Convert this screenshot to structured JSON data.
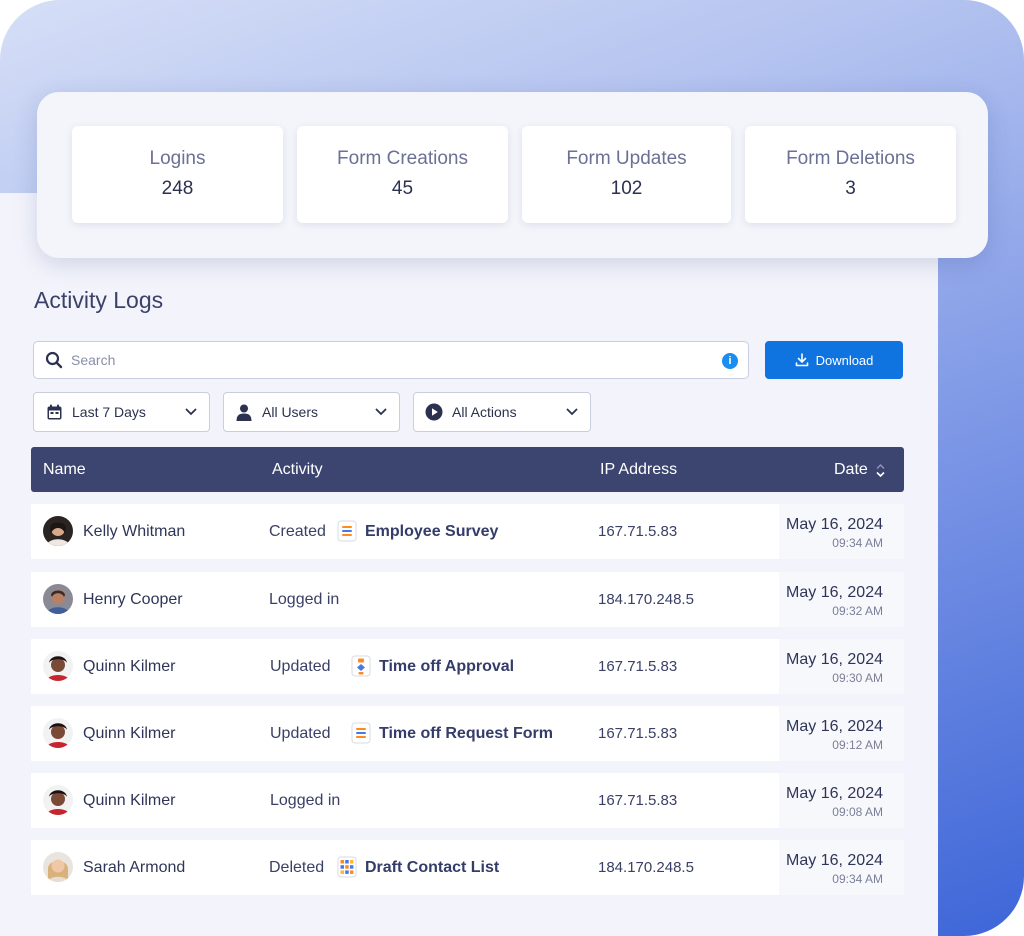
{
  "stats": [
    {
      "label": "Logins",
      "value": "248"
    },
    {
      "label": "Form Creations",
      "value": "45"
    },
    {
      "label": "Form Updates",
      "value": "102"
    },
    {
      "label": "Form Deletions",
      "value": "3"
    }
  ],
  "page_title": "Activity Logs",
  "search": {
    "placeholder": "Search",
    "value": ""
  },
  "download_label": "Download",
  "filters": {
    "date": {
      "label": "Last 7 Days",
      "icon": "calendar-icon"
    },
    "users": {
      "label": "All Users",
      "icon": "user-icon"
    },
    "actions": {
      "label": "All Actions",
      "icon": "play-circle-icon"
    }
  },
  "table": {
    "headers": {
      "name": "Name",
      "activity": "Activity",
      "ip": "IP Address",
      "date": "Date"
    },
    "rows": [
      {
        "name": "Kelly Whitman",
        "action": "Created",
        "form": "Employee Survey",
        "form_icon": "form-doc-icon",
        "ip": "167.71.5.83",
        "date": "May 16, 2024",
        "time": "09:34 AM"
      },
      {
        "name": "Henry Cooper",
        "action": "Logged in",
        "form": "",
        "form_icon": "",
        "ip": "184.170.248.5",
        "date": "May 16, 2024",
        "time": "09:32 AM"
      },
      {
        "name": "Quinn Kilmer",
        "action": "Updated",
        "form": "Time off Approval",
        "form_icon": "workflow-icon",
        "ip": "167.71.5.83",
        "date": "May 16, 2024",
        "time": "09:30 AM"
      },
      {
        "name": "Quinn Kilmer",
        "action": "Updated",
        "form": "Time off Request Form",
        "form_icon": "form-doc-icon",
        "ip": "167.71.5.83",
        "date": "May 16, 2024",
        "time": "09:12 AM"
      },
      {
        "name": "Quinn Kilmer",
        "action": "Logged in",
        "form": "",
        "form_icon": "",
        "ip": "167.71.5.83",
        "date": "May 16, 2024",
        "time": "09:08 AM"
      },
      {
        "name": "Sarah Armond",
        "action": "Deleted",
        "form": "Draft Contact List",
        "form_icon": "table-grid-icon",
        "ip": "184.170.248.5",
        "date": "May 16, 2024",
        "time": "09:34 AM"
      }
    ]
  },
  "colors": {
    "accent": "#0f73e0",
    "header": "#3b456f",
    "info": "#1a8df0"
  }
}
